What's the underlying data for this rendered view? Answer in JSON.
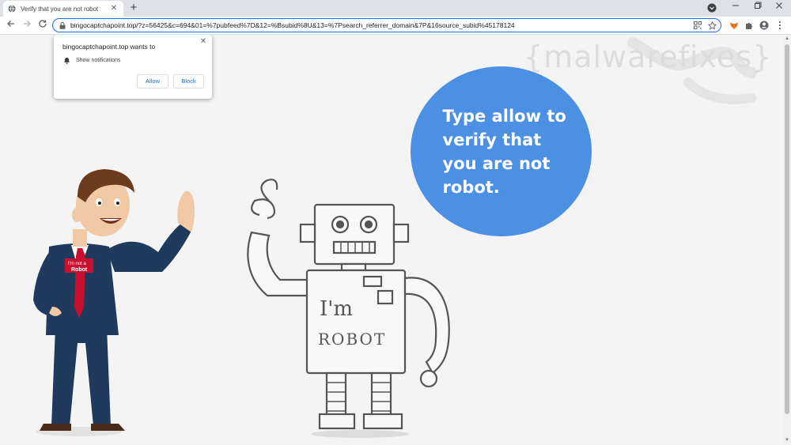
{
  "browser": {
    "tab_title": "Verify that you are not robot",
    "tab_close": "✕",
    "new_tab": "+",
    "url": "bingocaptchapoint.top/?z=56425&c=694&01=%7pubfeed%7D&12=%Bsubid%8U&13=%7Psearch_referrer_domain&7P&16source_subid%45178124",
    "icons": {
      "favicon": "globe-icon",
      "back": "back-arrow-icon",
      "forward": "forward-arrow-icon",
      "reload": "reload-icon",
      "lock": "lock-icon",
      "qr": "qr-icon",
      "star": "star-icon",
      "extension": "puzzle-icon",
      "profile": "profile-icon",
      "menu": "kebab-menu-icon"
    }
  },
  "notification_popup": {
    "title": "bingocaptchapoint.top wants to",
    "permission": "Show notifications",
    "allow_label": "Allow",
    "block_label": "Block",
    "close_label": "✕"
  },
  "page": {
    "bubble_text": "Type allow to verify that you are not robot.",
    "watermark": "{malwarefixes}",
    "man_badge_line1": "I'm not a",
    "man_badge_line2": "Robot",
    "robot_text_line1": "I'm",
    "robot_text_line2": "ROBOT"
  },
  "colors": {
    "bubble": "#4b90e2",
    "suit": "#1f3a5c",
    "tie": "#c8102e",
    "accent": "#1a73e8"
  }
}
